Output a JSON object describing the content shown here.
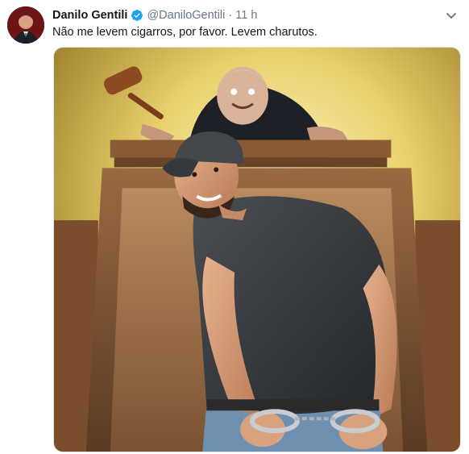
{
  "tweet": {
    "author_name": "Danilo Gentili",
    "author_handle": "@DaniloGentili",
    "separator": "·",
    "time": "11 h",
    "text": "Não me levem cigarros, por favor. Levem charutos.",
    "verified": true
  },
  "icons": {
    "verified": "verified-badge-icon",
    "menu": "chevron-down-icon"
  },
  "colors": {
    "verified_blue": "#1da1f2",
    "secondary_text": "#657786",
    "primary_text": "#14171a"
  }
}
